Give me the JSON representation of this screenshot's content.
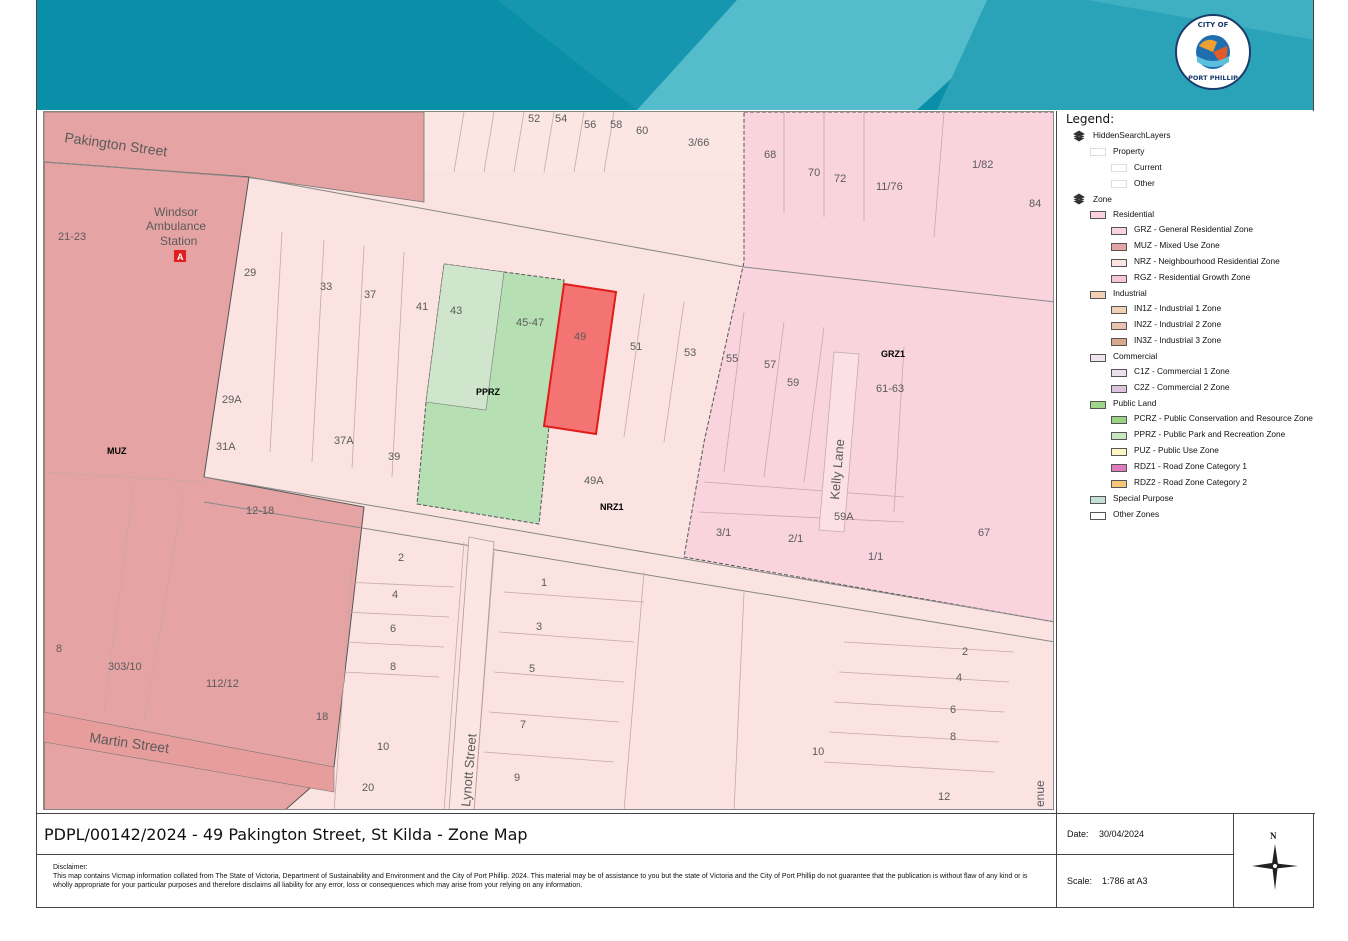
{
  "header": {
    "logo_top_text": "CITY OF",
    "logo_bottom_text": "PORT PHILLIP",
    "logo_icon": "city-of-port-phillip-logo"
  },
  "colors": {
    "header_dark": "#0a8fa8",
    "header_light": "#55bccb",
    "muz": "#e6a3a3",
    "nrz": "#fae3e1",
    "grz": "#f9d4de",
    "pprz": "#b6e0b3",
    "subject_site": "#f47474",
    "road": "#fce8e6"
  },
  "map": {
    "streets": {
      "pakington": "Pakington Street",
      "martin": "Martin Street",
      "lynott": "Lynott Street",
      "kelly": "Kelly Lane",
      "avenue_partial": "enue"
    },
    "landmark": {
      "line1": "Windsor",
      "line2": "Ambulance",
      "line3": "Station",
      "icon_letter": "A"
    },
    "zone_labels": {
      "muz": "MUZ",
      "pprz": "PPRZ",
      "nrz1": "NRZ1",
      "grz1": "GRZ1"
    },
    "lot_numbers": {
      "n52": "52",
      "n54": "54",
      "n56": "56",
      "n58": "58",
      "n60": "60",
      "n3_66": "3/66",
      "n68": "68",
      "n70": "70",
      "n72": "72",
      "n11_76": "11/76",
      "n1_82": "1/82",
      "n84": "84",
      "n21_23": "21-23",
      "n29": "29",
      "n33": "33",
      "n37": "37",
      "n41": "41",
      "n43": "43",
      "n45_47": "45-47",
      "n49": "49",
      "n51": "51",
      "n53": "53",
      "n55": "55",
      "n57": "57",
      "n59": "59",
      "n61_63": "61-63",
      "n29a": "29A",
      "n31a": "31A",
      "n37a": "37A",
      "n39": "39",
      "n49a": "49A",
      "n59a": "59A",
      "n3_1": "3/1",
      "n2_1": "2/1",
      "n1_1": "1/1",
      "n67": "67",
      "n12_18": "12-18",
      "n2": "2",
      "n4": "4",
      "n6": "6",
      "n8": "8",
      "n1": "1",
      "n3": "3",
      "n5": "5",
      "n7": "7",
      "n9": "9",
      "n10": "10",
      "n20": "20",
      "n8w": "8",
      "n303_10": "303/10",
      "n112_12": "112/12",
      "n18": "18",
      "n2e": "2",
      "n4e": "4",
      "n6e": "6",
      "n8e": "8",
      "n10e": "10",
      "n12e": "12"
    }
  },
  "legend": {
    "title": "Legend:",
    "hidden_layers": "HiddenSearchLayers",
    "property": "Property",
    "current": "Current",
    "other": "Other",
    "zone": "Zone",
    "residential": "Residential",
    "grz": "GRZ - General Residential Zone",
    "muz": "MUZ - Mixed Use Zone",
    "nrz": "NRZ - Neighbourhood Residential Zone",
    "rgz": "RGZ - Residential Growth Zone",
    "industrial": "Industrial",
    "in1z": "IN1Z - Industrial 1 Zone",
    "in2z": "IN2Z - Industrial 2 Zone",
    "in3z": "IN3Z - Industrial 3 Zone",
    "commercial": "Commercial",
    "c1z": "C1Z - Commercial 1 Zone",
    "c2z": "C2Z - Commercial 2 Zone",
    "public_land": "Public Land",
    "pcrz": "PCRZ - Public Conservation and Resource Zone",
    "pprz": "PPRZ - Public Park and Recreation Zone",
    "puz": "PUZ - Public Use Zone",
    "rdz1": "RDZ1 - Road Zone Category 1",
    "rdz2": "RDZ2 - Road Zone Category 2",
    "special_purpose": "Special Purpose",
    "other_zones": "Other Zones"
  },
  "footer": {
    "title": "PDPL/00142/2024 - 49 Pakington Street, St Kilda - Zone Map",
    "date_label": "Date:",
    "date_value": "30/04/2024",
    "scale_label": "Scale:",
    "scale_value": "1:786 at A3",
    "north_letter": "N",
    "disclaimer_heading": "Disclaimer:",
    "disclaimer_text": "This map contains Vicmap information collated from The State of Victoria, Department of Sustainability and Environment and the City of Port Phillip. 2024.  This material may be of assistance to you but the state of Victoria and the City of Port Phillip do not guarantee that the publication is without flaw of any kind or is wholly appropriate for your particular purposes and therefore disclaims all liability for any error, loss or consequences which may arise from your relying on any information."
  }
}
